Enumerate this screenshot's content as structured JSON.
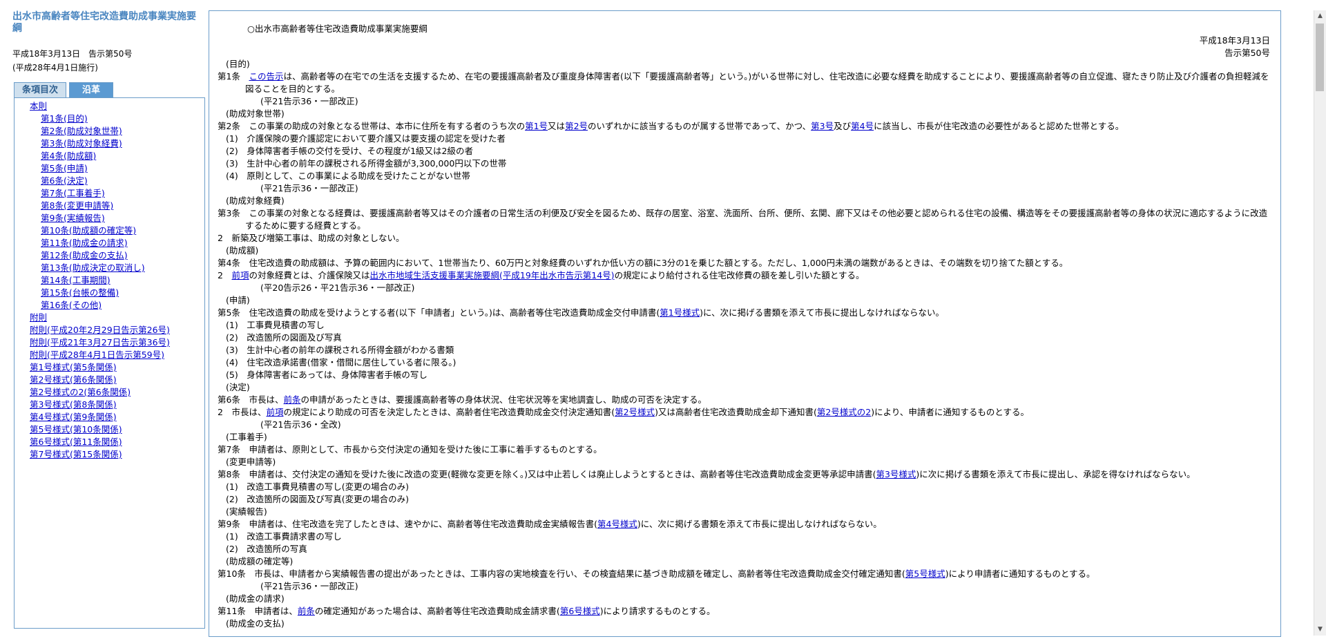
{
  "left": {
    "title": "出水市高齢者等住宅改造費助成事業実施要綱",
    "meta_line1": "平成18年3月13日　告示第50号",
    "meta_line2": "(平成28年4月1日施行)",
    "tabs": [
      "条項目次",
      "沿革"
    ],
    "toc": [
      {
        "label": "本則",
        "level": 1
      },
      {
        "label": "第1条(目的)",
        "level": 2
      },
      {
        "label": "第2条(助成対象世帯)",
        "level": 2
      },
      {
        "label": "第3条(助成対象経費)",
        "level": 2
      },
      {
        "label": "第4条(助成額)",
        "level": 2
      },
      {
        "label": "第5条(申請)",
        "level": 2
      },
      {
        "label": "第6条(決定)",
        "level": 2
      },
      {
        "label": "第7条(工事着手)",
        "level": 2
      },
      {
        "label": "第8条(変更申請等)",
        "level": 2
      },
      {
        "label": "第9条(実績報告)",
        "level": 2
      },
      {
        "label": "第10条(助成額の確定等)",
        "level": 2
      },
      {
        "label": "第11条(助成金の請求)",
        "level": 2
      },
      {
        "label": "第12条(助成金の支払)",
        "level": 2
      },
      {
        "label": "第13条(助成決定の取消し)",
        "level": 2
      },
      {
        "label": "第14条(工事期間)",
        "level": 2
      },
      {
        "label": "第15条(台帳の整備)",
        "level": 2
      },
      {
        "label": "第16条(その他)",
        "level": 2
      },
      {
        "label": "附則",
        "level": 1
      },
      {
        "label": "附則(平成20年2月29日告示第26号)",
        "level": 1
      },
      {
        "label": "附則(平成21年3月27日告示第36号)",
        "level": 1
      },
      {
        "label": "附則(平成28年4月1日告示第59号)",
        "level": 1
      },
      {
        "label": "第1号様式(第5条関係)",
        "level": 1
      },
      {
        "label": "第2号様式(第6条関係)",
        "level": 1
      },
      {
        "label": "第2号様式の2(第6条関係)",
        "level": 1
      },
      {
        "label": "第3号様式(第8条関係)",
        "level": 1
      },
      {
        "label": "第4号様式(第9条関係)",
        "level": 1
      },
      {
        "label": "第5号様式(第10条関係)",
        "level": 1
      },
      {
        "label": "第6号様式(第11条関係)",
        "level": 1
      },
      {
        "label": "第7号様式(第15条関係)",
        "level": 1
      }
    ]
  },
  "main": {
    "title": "○出水市高齢者等住宅改造費助成事業実施要綱",
    "date": "平成18年3月13日",
    "notice": "告示第50号",
    "lines": [
      {
        "type": "cap",
        "parts": [
          {
            "t": "(目的)"
          }
        ]
      },
      {
        "type": "wrap",
        "parts": [
          {
            "t": "第1条　"
          },
          {
            "t": "この告示",
            "link": true
          },
          {
            "t": "は、高齢者等の在宅での生活を支援するため、在宅の要援護高齢者及び重度身体障害者(以下「要援護高齢者等」という。)がいる世帯に対し、住宅改造に必要な経費を助成することにより、要援護高齢者等の自立促進、寝たきり防止及び介護者の負担軽減を図ることを目的とする。"
          }
        ]
      },
      {
        "type": "note",
        "parts": [
          {
            "t": "(平21告示36・一部改正)"
          }
        ]
      },
      {
        "type": "cap",
        "parts": [
          {
            "t": "(助成対象世帯)"
          }
        ]
      },
      {
        "type": "plain",
        "parts": [
          {
            "t": "第2条　この事業の助成の対象となる世帯は、本市に住所を有する者のうち次の"
          },
          {
            "t": "第1号",
            "link": true
          },
          {
            "t": "又は"
          },
          {
            "t": "第2号",
            "link": true
          },
          {
            "t": "のいずれかに該当するものが属する世帯であって、かつ、"
          },
          {
            "t": "第3号",
            "link": true
          },
          {
            "t": "及び"
          },
          {
            "t": "第4号",
            "link": true
          },
          {
            "t": "に該当し、市長が住宅改造の必要性があると認めた世帯とする。"
          }
        ]
      },
      {
        "type": "item",
        "parts": [
          {
            "t": "(1)　介護保険の要介護認定において要介護又は要支援の認定を受けた者"
          }
        ]
      },
      {
        "type": "item",
        "parts": [
          {
            "t": "(2)　身体障害者手帳の交付を受け、その程度が1級又は2級の者"
          }
        ]
      },
      {
        "type": "item",
        "parts": [
          {
            "t": "(3)　生計中心者の前年の課税される所得金額が3,300,000円以下の世帯"
          }
        ]
      },
      {
        "type": "item",
        "parts": [
          {
            "t": "(4)　原則として、この事業による助成を受けたことがない世帯"
          }
        ]
      },
      {
        "type": "note",
        "parts": [
          {
            "t": "(平21告示36・一部改正)"
          }
        ]
      },
      {
        "type": "cap",
        "parts": [
          {
            "t": "(助成対象経費)"
          }
        ]
      },
      {
        "type": "wrap",
        "parts": [
          {
            "t": "第3条　この事業の対象となる経費は、要援護高齢者等又はその介護者の日常生活の利便及び安全を図るため、既存の居室、浴室、洗面所、台所、便所、玄関、廊下又はその他必要と認められる住宅の設備、構造等をその要援護高齢者等の身体の状況に適応するように改造するために要する経費とする。"
          }
        ]
      },
      {
        "type": "plain",
        "parts": [
          {
            "t": "2　新築及び増築工事は、助成の対象としない。"
          }
        ]
      },
      {
        "type": "cap",
        "parts": [
          {
            "t": "(助成額)"
          }
        ]
      },
      {
        "type": "plain",
        "parts": [
          {
            "t": "第4条　住宅改造費の助成額は、予算の範囲内において、1世帯当たり、60万円と対象経費のいずれか低い方の額に3分の1を乗じた額とする。ただし、1,000円未満の端数があるときは、その端数を切り捨てた額とする。"
          }
        ]
      },
      {
        "type": "plain",
        "parts": [
          {
            "t": "2　"
          },
          {
            "t": "前項",
            "link": true
          },
          {
            "t": "の対象経費とは、介護保険又は"
          },
          {
            "t": "出水市地域生活支援事業実施要綱(平成19年出水市告示第14号)",
            "link": true
          },
          {
            "t": "の規定により給付される住宅改修費の額を差し引いた額とする。"
          }
        ]
      },
      {
        "type": "note",
        "parts": [
          {
            "t": "(平20告示26・平21告示36・一部改正)"
          }
        ]
      },
      {
        "type": "cap",
        "parts": [
          {
            "t": "(申請)"
          }
        ]
      },
      {
        "type": "plain",
        "parts": [
          {
            "t": "第5条　住宅改造費の助成を受けようとする者(以下「申請者」という。)は、高齢者等住宅改造費助成金交付申請書("
          },
          {
            "t": "第1号様式",
            "link": true
          },
          {
            "t": ")に、次に掲げる書類を添えて市長に提出しなければならない。"
          }
        ]
      },
      {
        "type": "item",
        "parts": [
          {
            "t": "(1)　工事費見積書の写し"
          }
        ]
      },
      {
        "type": "item",
        "parts": [
          {
            "t": "(2)　改造箇所の図面及び写真"
          }
        ]
      },
      {
        "type": "item",
        "parts": [
          {
            "t": "(3)　生計中心者の前年の課税される所得金額がわかる書類"
          }
        ]
      },
      {
        "type": "item",
        "parts": [
          {
            "t": "(4)　住宅改造承諾書(借家・借間に居住している者に限る。)"
          }
        ]
      },
      {
        "type": "item",
        "parts": [
          {
            "t": "(5)　身体障害者にあっては、身体障害者手帳の写し"
          }
        ]
      },
      {
        "type": "cap",
        "parts": [
          {
            "t": "(決定)"
          }
        ]
      },
      {
        "type": "plain",
        "parts": [
          {
            "t": "第6条　市長は、"
          },
          {
            "t": "前条",
            "link": true
          },
          {
            "t": "の申請があったときは、要援護高齢者等の身体状況、住宅状況等を実地調査し、助成の可否を決定する。"
          }
        ]
      },
      {
        "type": "plain",
        "parts": [
          {
            "t": "2　市長は、"
          },
          {
            "t": "前項",
            "link": true
          },
          {
            "t": "の規定により助成の可否を決定したときは、高齢者住宅改造費助成金交付決定通知書("
          },
          {
            "t": "第2号様式",
            "link": true
          },
          {
            "t": ")又は高齢者住宅改造費助成金却下通知書("
          },
          {
            "t": "第2号様式の2",
            "link": true
          },
          {
            "t": ")により、申請者に通知するものとする。"
          }
        ]
      },
      {
        "type": "note",
        "parts": [
          {
            "t": "(平21告示36・全改)"
          }
        ]
      },
      {
        "type": "cap",
        "parts": [
          {
            "t": "(工事着手)"
          }
        ]
      },
      {
        "type": "plain",
        "parts": [
          {
            "t": "第7条　申請者は、原則として、市長から交付決定の通知を受けた後に工事に着手するものとする。"
          }
        ]
      },
      {
        "type": "cap",
        "parts": [
          {
            "t": "(変更申請等)"
          }
        ]
      },
      {
        "type": "wrap",
        "parts": [
          {
            "t": "第8条　申請者は、交付決定の通知を受けた後に改造の変更(軽微な変更を除く。)又は中止若しくは廃止しようとするときは、高齢者等住宅改造費助成金変更等承認申請書("
          },
          {
            "t": "第3号様式",
            "link": true
          },
          {
            "t": ")に次に掲げる書類を添えて市長に提出し、承認を得なければならない。"
          }
        ]
      },
      {
        "type": "item",
        "parts": [
          {
            "t": "(1)　改造工事費見積書の写し(変更の場合のみ)"
          }
        ]
      },
      {
        "type": "item",
        "parts": [
          {
            "t": "(2)　改造箇所の図面及び写真(変更の場合のみ)"
          }
        ]
      },
      {
        "type": "cap",
        "parts": [
          {
            "t": "(実績報告)"
          }
        ]
      },
      {
        "type": "plain",
        "parts": [
          {
            "t": "第9条　申請者は、住宅改造を完了したときは、速やかに、高齢者等住宅改造費助成金実績報告書("
          },
          {
            "t": "第4号様式",
            "link": true
          },
          {
            "t": ")に、次に掲げる書類を添えて市長に提出しなければならない。"
          }
        ]
      },
      {
        "type": "item",
        "parts": [
          {
            "t": "(1)　改造工事費請求書の写し"
          }
        ]
      },
      {
        "type": "item",
        "parts": [
          {
            "t": "(2)　改造箇所の写真"
          }
        ]
      },
      {
        "type": "cap",
        "parts": [
          {
            "t": "(助成額の確定等)"
          }
        ]
      },
      {
        "type": "plain",
        "parts": [
          {
            "t": "第10条　市長は、申請者から実績報告書の提出があったときは、工事内容の実地検査を行い、その検査結果に基づき助成額を確定し、高齢者等住宅改造費助成金交付確定通知書("
          },
          {
            "t": "第5号様式",
            "link": true
          },
          {
            "t": ")により申請者に通知するものとする。"
          }
        ]
      },
      {
        "type": "note",
        "parts": [
          {
            "t": "(平21告示36・一部改正)"
          }
        ]
      },
      {
        "type": "cap",
        "parts": [
          {
            "t": "(助成金の請求)"
          }
        ]
      },
      {
        "type": "plain",
        "parts": [
          {
            "t": "第11条　申請者は、"
          },
          {
            "t": "前条",
            "link": true
          },
          {
            "t": "の確定通知があった場合は、高齢者等住宅改造費助成金請求書("
          },
          {
            "t": "第6号様式",
            "link": true
          },
          {
            "t": ")により請求するものとする。"
          }
        ]
      },
      {
        "type": "cap",
        "parts": [
          {
            "t": "(助成金の支払)"
          }
        ]
      }
    ]
  }
}
